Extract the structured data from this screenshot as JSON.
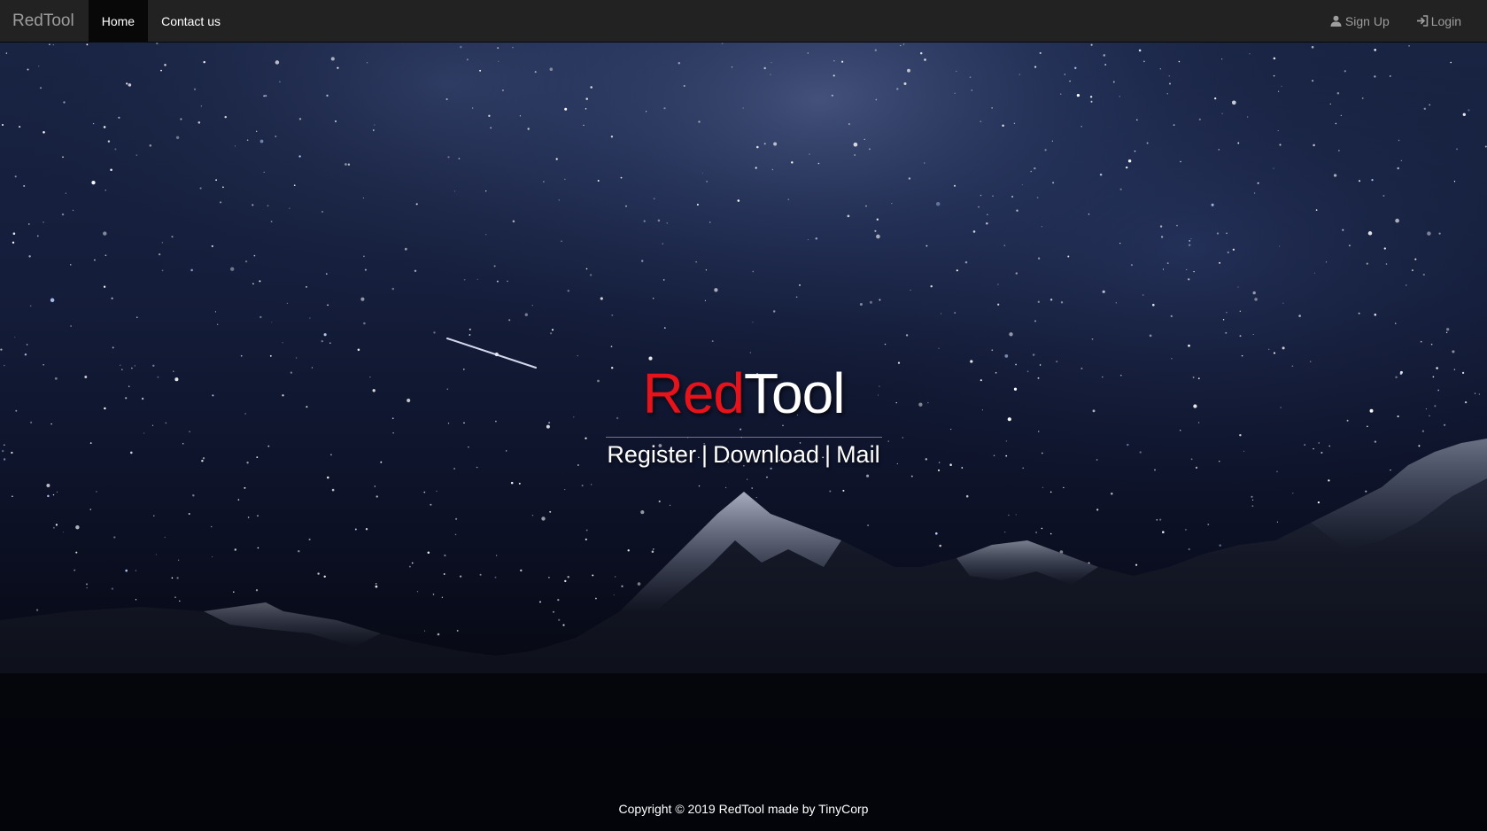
{
  "navbar": {
    "brand": "RedTool",
    "items": [
      {
        "label": "Home",
        "active": true
      },
      {
        "label": "Contact us",
        "active": false
      }
    ],
    "right_items": [
      {
        "label": "Sign Up",
        "icon": "user-icon"
      },
      {
        "label": "Login",
        "icon": "login-icon"
      }
    ]
  },
  "hero": {
    "title_red": "Red",
    "title_white": "Tool",
    "links": [
      "Register",
      "Download",
      "Mail"
    ],
    "separator": "|"
  },
  "footer": {
    "text": "Copyright © 2019 RedTool made by TinyCorp"
  },
  "colors": {
    "navbar_bg": "#222222",
    "active_bg": "#080808",
    "accent_red": "#e8131a",
    "muted_text": "#9d9d9d"
  },
  "background": {
    "image": "night-sky-mountains"
  }
}
